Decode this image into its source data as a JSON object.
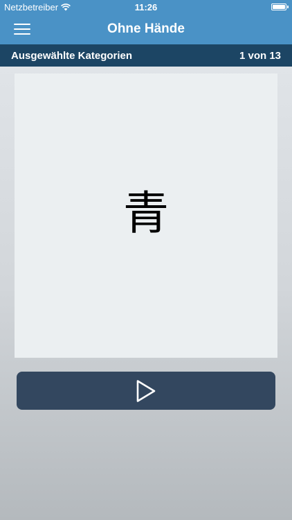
{
  "status_bar": {
    "carrier": "Netzbetreiber",
    "time": "11:26",
    "wifi_icon": "wifi-icon",
    "battery_icon": "battery-icon"
  },
  "navbar": {
    "title": "Ohne Hände",
    "menu_icon": "hamburger-menu-icon"
  },
  "subbar": {
    "category_label": "Ausgewählte Kategorien",
    "counter": "1 von 13"
  },
  "card": {
    "character": "青"
  },
  "controls": {
    "play_icon": "play-icon"
  },
  "colors": {
    "navbar": "#4a92c6",
    "subbar": "#1c4564",
    "card": "#ebeff1",
    "play_button": "#33475f"
  }
}
